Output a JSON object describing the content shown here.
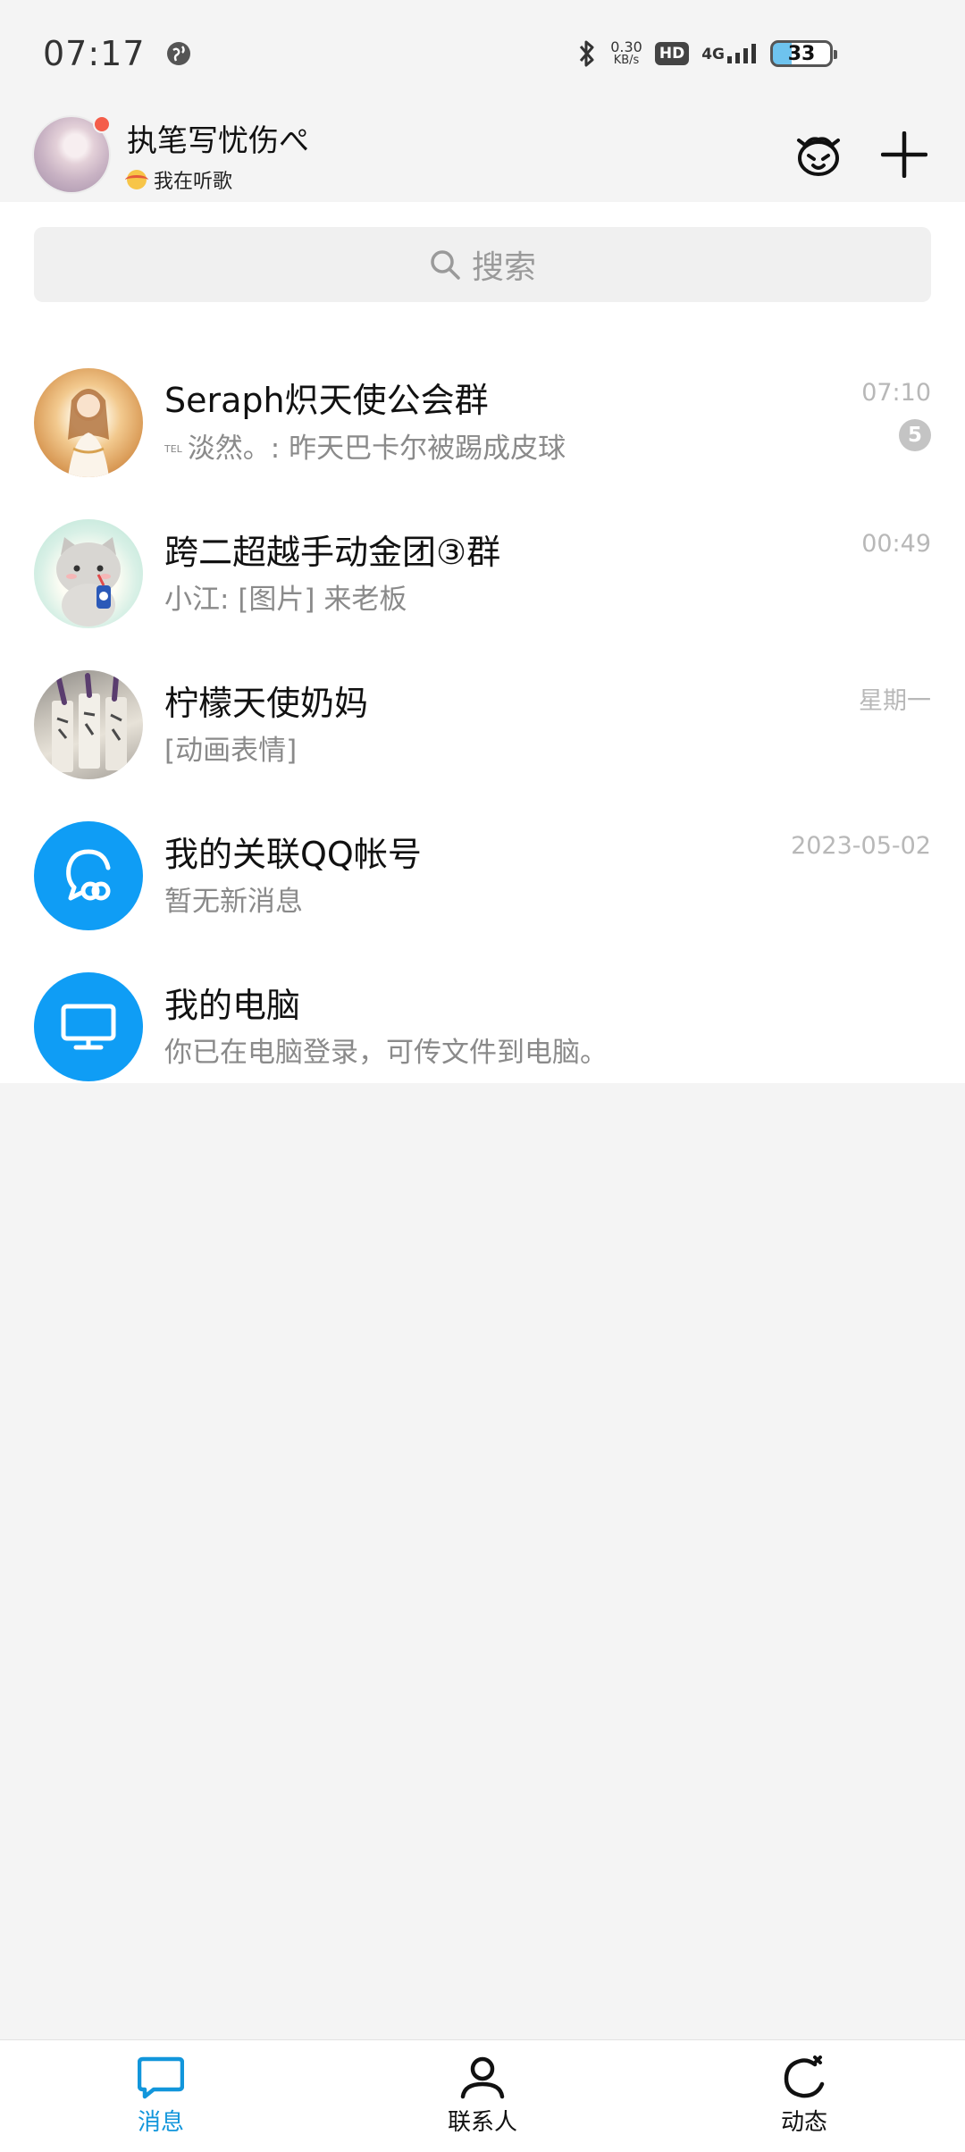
{
  "status_bar": {
    "time": "07:17",
    "net_speed_value": "0.30",
    "net_speed_unit": "KB/s",
    "hd_label": "HD",
    "network_label": "4G",
    "battery_level": "33"
  },
  "header": {
    "username": "执笔写忧伤ぺ",
    "status_text": "我在听歌"
  },
  "search": {
    "placeholder": "搜索"
  },
  "chats": [
    {
      "name": "Seraph炽天使公会群",
      "tag": "TEL",
      "preview": "淡然。: 昨天巴卡尔被踢成皮球",
      "time": "07:10",
      "unread": "5"
    },
    {
      "name": "跨二超越手动金团③群",
      "preview": "小江: [图片] 来老板",
      "time": "00:49"
    },
    {
      "name": "柠檬天使奶妈",
      "preview": "[动画表情]",
      "time": "星期一"
    },
    {
      "name": "我的关联QQ帐号",
      "preview": "暂无新消息",
      "time": "2023-05-02"
    },
    {
      "name": "我的电脑",
      "preview": "你已在电脑登录，可传文件到电脑。"
    }
  ],
  "bottom_nav": {
    "messages": "消息",
    "contacts": "联系人",
    "moments": "动态"
  },
  "colors": {
    "accent": "#1296db",
    "avatar_blue": "#0f9df5",
    "badge_gray": "#c4c4c4",
    "notify_red": "#f45d4a"
  }
}
